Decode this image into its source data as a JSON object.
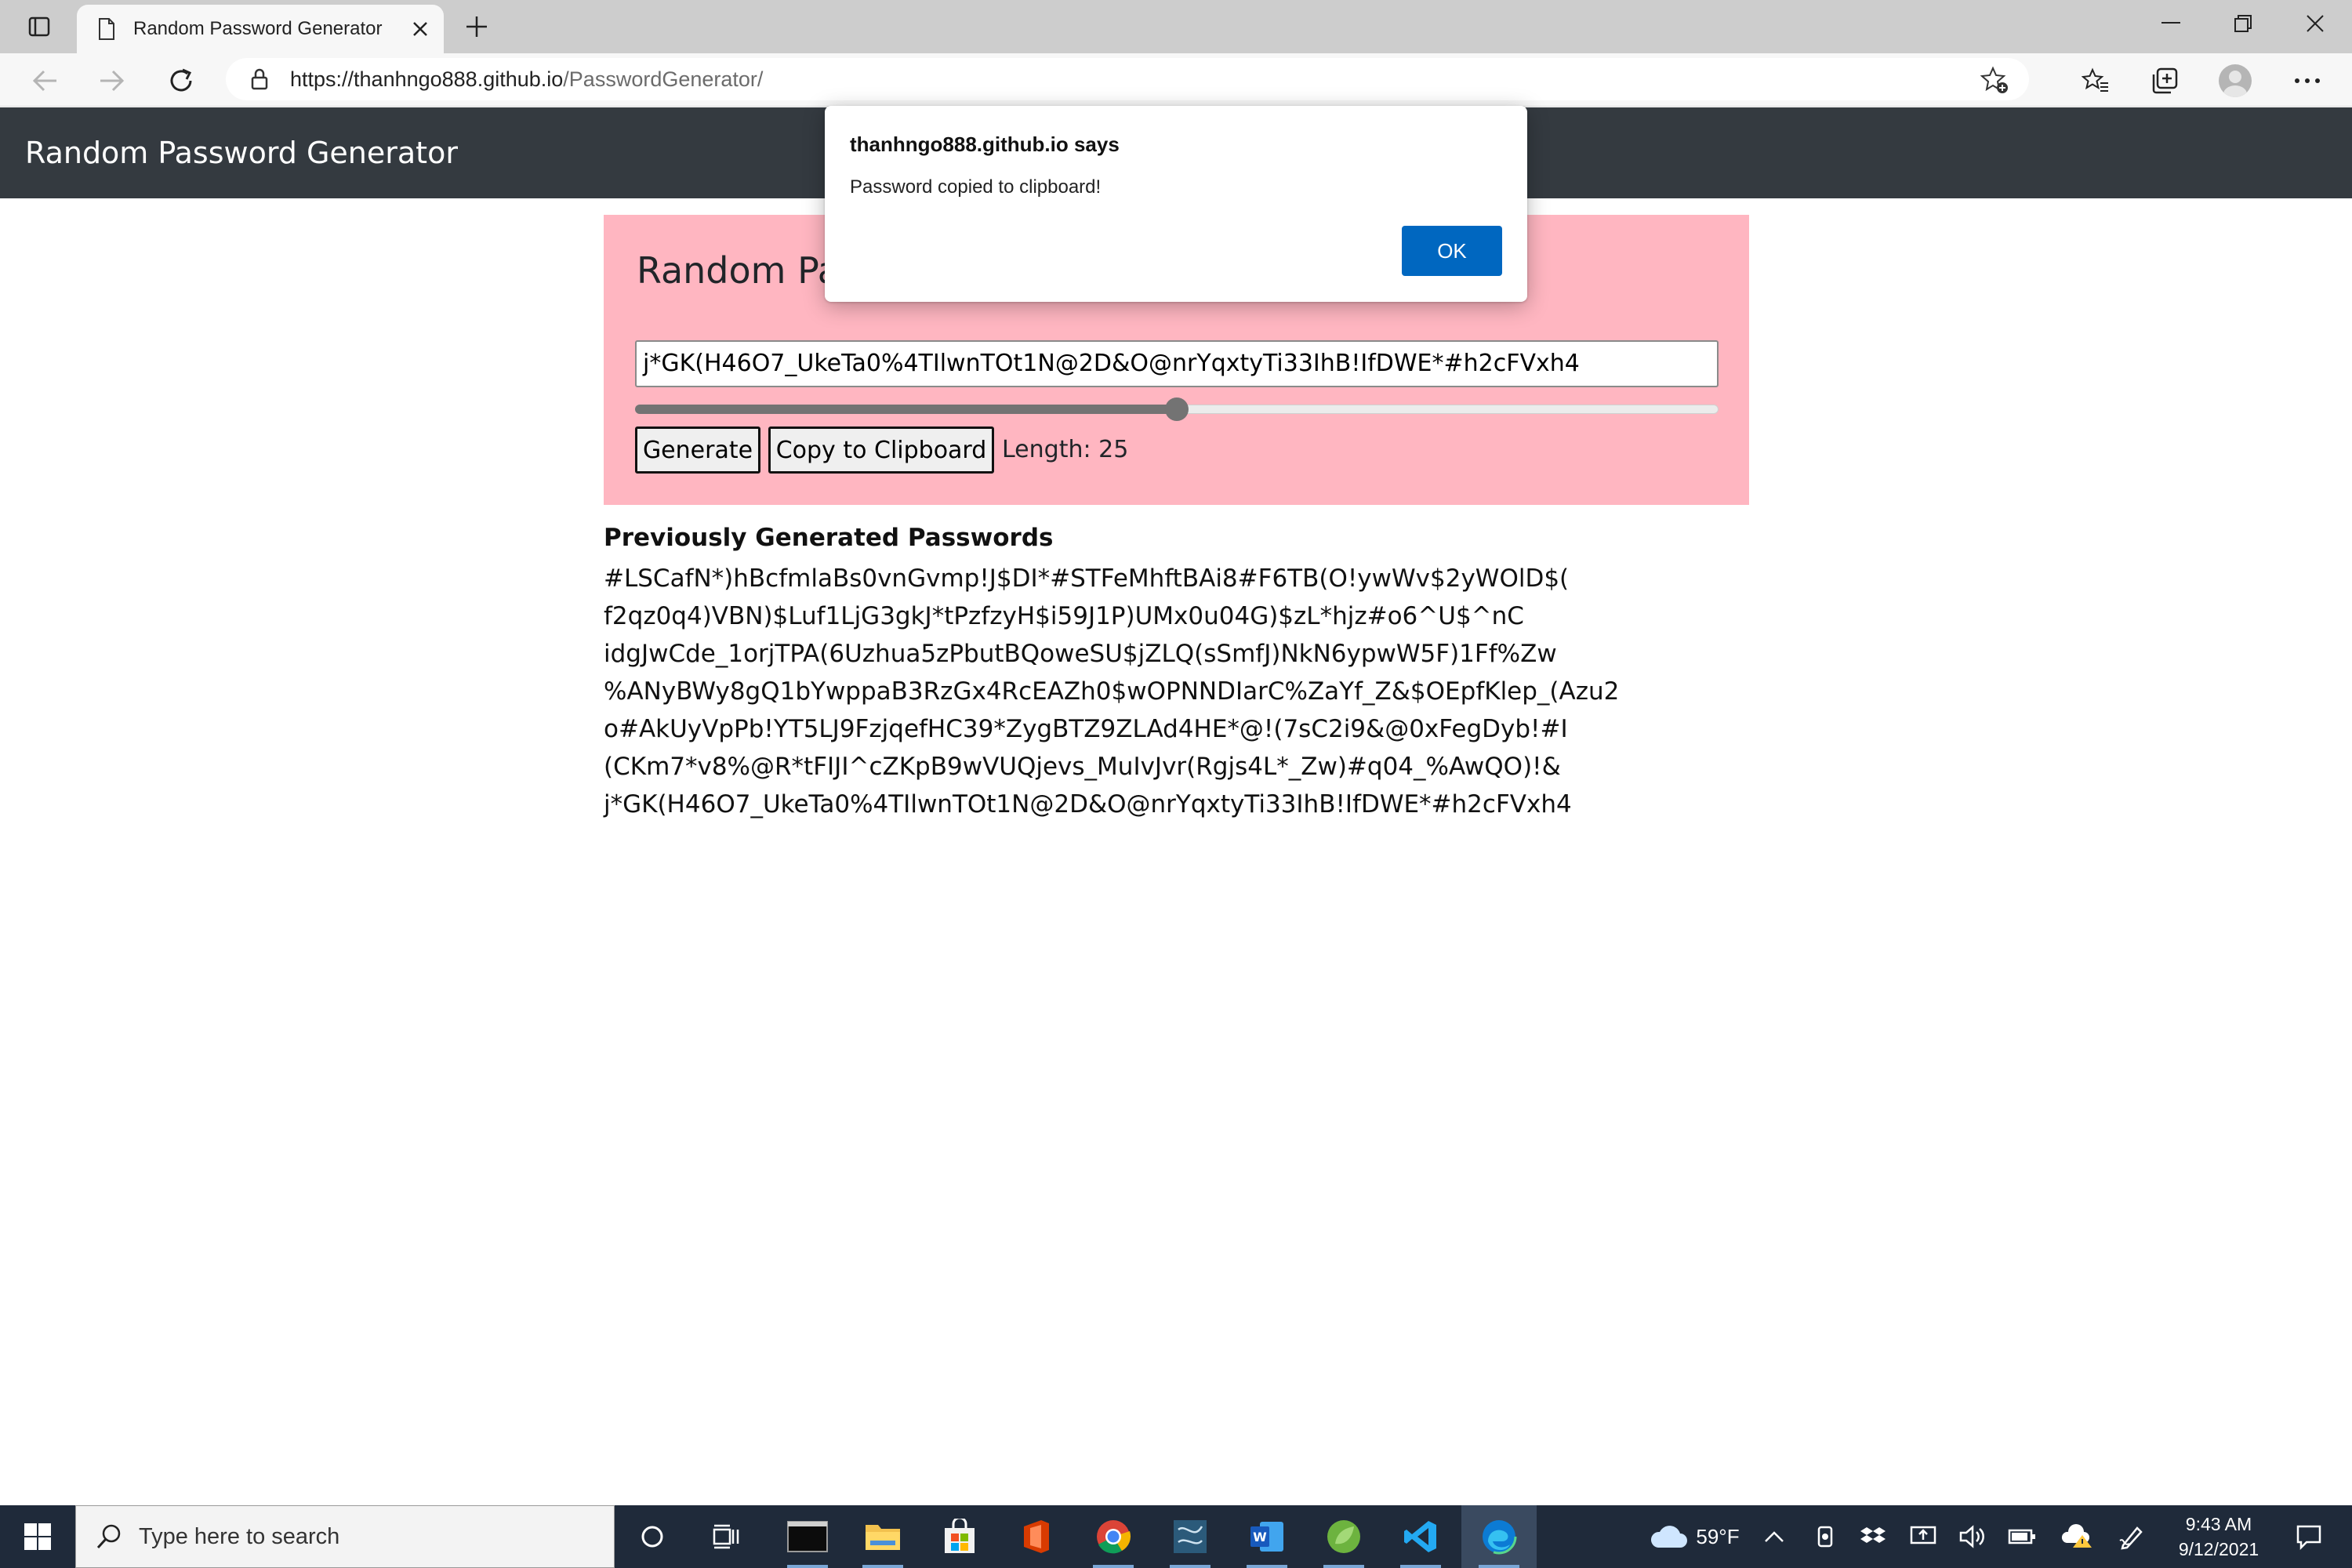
{
  "browser": {
    "tab_title": "Random Password Generator",
    "url_host": "https://thanhngo888.github.io",
    "url_path": "/PasswordGenerator/"
  },
  "app": {
    "brand": "Random Password Generator",
    "card_title": "Random Pa",
    "password_value": "j*GK(H46O7_UkeTa0%4TIlwnTOt1N@2D&O@nrYqxtyTi33IhB!IfDWE*#h2cFVxh4",
    "slider_fraction": 0.5,
    "generate_label": "Generate",
    "copy_label": "Copy to Clipboard",
    "length_label": "Length: 25",
    "history_title": "Previously Generated Passwords",
    "history": [
      "#LSCafN*)hBcfmlaBs0vnGvmp!J$DI*#STFeMhftBAi8#F6TB(O!ywWv$2yWOlD$(",
      "f2qz0q4)VBN)$Luf1LjG3gkJ*tPzfzyH$i59J1P)UMx0u04G)$zL*hjz#o6^U$^nC",
      "idgJwCde_1orjTPA(6Uzhua5zPbutBQoweSU$jZLQ(sSmfJ)NkN6ypwW5F)1Ff%Zw",
      "%ANyBWy8gQ1bYwppaB3RzGx4RcEAZh0$wOPNNDIarC%ZaYf_Z&$OEpfKlep_(Azu2",
      "o#AkUyVpPb!YT5LJ9FzjqefHC39*ZygBTZ9ZLAd4HE*@!(7sC2i9&@0xFegDyb!#I",
      "(CKm7*v8%@R*tFIJI^cZKpB9wVUQjevs_MuIvJvr(Rgjs4L*_Zw)#q04_%AwQO)!&",
      "j*GK(H46O7_UkeTa0%4TIlwnTOt1N@2D&O@nrYqxtyTi33IhB!IfDWE*#h2cFVxh4"
    ],
    "card_color": "#ffb6c1",
    "navbar_color": "#343a40"
  },
  "dialog": {
    "title": "thanhngo888.github.io says",
    "message": "Password copied to clipboard!",
    "ok_label": "OK",
    "accent": "#0067c0"
  },
  "taskbar": {
    "search_placeholder": "Type here to search",
    "weather": "59°F",
    "time": "9:43 AM",
    "date": "9/12/2021",
    "apps": [
      "cortana-icon",
      "task-view-icon",
      "terminal-icon",
      "file-explorer-icon",
      "store-icon",
      "office-icon",
      "chrome-icon",
      "sql-icon",
      "word-icon",
      "spring-icon",
      "vscode-icon",
      "edge-icon"
    ]
  }
}
